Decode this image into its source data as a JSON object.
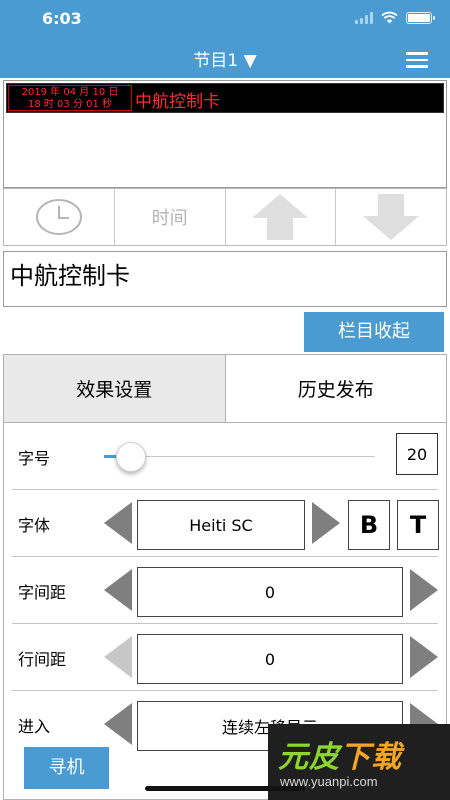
{
  "status": {
    "time": "6:03"
  },
  "header": {
    "title": "节目1 ▼"
  },
  "preview": {
    "date_line1": "2019 年 04 月 10 日",
    "date_line2": "18 时 03 分 01 秒",
    "scroll_text": "中航控制卡"
  },
  "toolbar": {
    "time_label": "时间"
  },
  "text_input": {
    "value": "中航控制卡"
  },
  "buttons": {
    "collapse": "栏目收起",
    "scan": "寻机"
  },
  "tabs": [
    {
      "label": "效果设置",
      "active": true
    },
    {
      "label": "历史发布",
      "active": false
    }
  ],
  "settings": {
    "font_size": {
      "label": "字号",
      "value": "20",
      "slider_fraction": 0.1
    },
    "font_family": {
      "label": "字体",
      "value": "Heiti SC",
      "bold_label": "B",
      "text_label": "T"
    },
    "char_spacing": {
      "label": "字间距",
      "value": "0"
    },
    "line_spacing": {
      "label": "行间距",
      "value": "0"
    },
    "enter": {
      "label": "进入",
      "value": "连续左移显示"
    }
  },
  "watermark": {
    "logo_a": "元皮",
    "logo_b": "下载",
    "url": "www.yuanpi.com"
  },
  "colors": {
    "accent": "#4a9bd1",
    "led_red": "#ff2a2a",
    "arrow_gray": "#7f7f7f"
  },
  "icons": [
    "wifi-icon",
    "battery-icon",
    "menu-icon",
    "clock-icon",
    "arrow-up-icon",
    "arrow-down-icon"
  ]
}
